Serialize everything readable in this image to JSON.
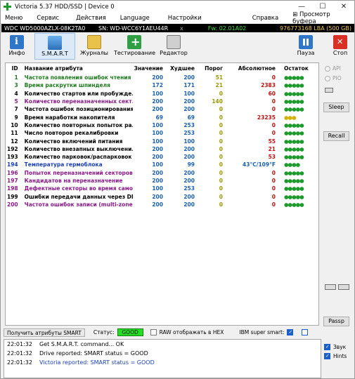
{
  "window": {
    "title": "Victoria 5.37 HDD/SSD | Device 0",
    "controls": [
      "—",
      "☐",
      "✕"
    ]
  },
  "menu": [
    "Меню",
    "Сервис",
    "Действия",
    "Language",
    "Настройки",
    "Справка",
    "Просмотр буфера"
  ],
  "drive": {
    "model": "WDC WD5000AZLX-08K2TA0",
    "serial": "SN: WD-WCC6Y1AEU44R",
    "close": "x",
    "firmware": "Fw: 02.01A02",
    "lba": "976773168 LBA (500 GB)"
  },
  "toolbar": {
    "info": "Инфо",
    "smart": "S.M.A.R.T",
    "logs": "Журналы",
    "test": "Тестирование",
    "editor": "Редактор",
    "pause": "Пауза",
    "stop": "Стоп"
  },
  "table": {
    "headers": [
      "ID",
      "Название атрибута",
      "Значение",
      "Худшее",
      "Порог",
      "Абсолютное",
      "Остаток"
    ],
    "rows": [
      {
        "id": "1",
        "name": "Частота появления ошибок чтения",
        "value": "200",
        "worst": "200",
        "threshold": "51",
        "raw": "0",
        "rest": "●●●●●",
        "color": "green"
      },
      {
        "id": "3",
        "name": "Время раскрутки шпинделя",
        "value": "172",
        "worst": "171",
        "threshold": "21",
        "raw": "2383",
        "rest": "●●●●●",
        "color": "green"
      },
      {
        "id": "4",
        "name": "Количество стартов или пробужде...",
        "value": "100",
        "worst": "100",
        "threshold": "0",
        "raw": "60",
        "rest": "●●●●●",
        "color": "black"
      },
      {
        "id": "5",
        "name": "Количество переназначенных сект...",
        "value": "200",
        "worst": "200",
        "threshold": "140",
        "raw": "0",
        "rest": "●●●●●",
        "color": "purple"
      },
      {
        "id": "7",
        "name": "Частота ошибок позиционирования",
        "value": "200",
        "worst": "200",
        "threshold": "0",
        "raw": "0",
        "rest": "●●●●●",
        "color": "black"
      },
      {
        "id": "9",
        "name": "Время наработки накопителя",
        "value": "69",
        "worst": "69",
        "threshold": "0",
        "raw": "23235",
        "rest": "●●●",
        "color": "black",
        "rest_color": "yellow"
      },
      {
        "id": "10",
        "name": "Количество повторных попыток ра...",
        "value": "100",
        "worst": "253",
        "threshold": "0",
        "raw": "0",
        "rest": "●●●●●",
        "color": "black"
      },
      {
        "id": "11",
        "name": "Число повторов рекалибровки",
        "value": "100",
        "worst": "253",
        "threshold": "0",
        "raw": "0",
        "rest": "●●●●●",
        "color": "black"
      },
      {
        "id": "12",
        "name": "Количество включений питания",
        "value": "100",
        "worst": "100",
        "threshold": "0",
        "raw": "55",
        "rest": "●●●●●",
        "color": "black"
      },
      {
        "id": "192",
        "name": "Количество внезапных выключени...",
        "value": "200",
        "worst": "200",
        "threshold": "0",
        "raw": "21",
        "rest": "●●●●●",
        "color": "black"
      },
      {
        "id": "193",
        "name": "Количество парковок/распарковок",
        "value": "200",
        "worst": "200",
        "threshold": "0",
        "raw": "53",
        "rest": "●●●●●",
        "color": "black"
      },
      {
        "id": "194",
        "name": "Температура гермоблока",
        "value": "100",
        "worst": "99",
        "threshold": "0",
        "raw": "43°C/109°F",
        "rest": "●●●●",
        "color": "blue",
        "raw_color": "blue"
      },
      {
        "id": "196",
        "name": "Попыток переназначений секторов",
        "value": "200",
        "worst": "200",
        "threshold": "0",
        "raw": "0",
        "rest": "●●●●●",
        "color": "purple"
      },
      {
        "id": "197",
        "name": "Кандидатов на переназначение",
        "value": "200",
        "worst": "200",
        "threshold": "0",
        "raw": "0",
        "rest": "●●●●●",
        "color": "purple"
      },
      {
        "id": "198",
        "name": "Дефектные секторы во время само...",
        "value": "100",
        "worst": "253",
        "threshold": "0",
        "raw": "0",
        "rest": "●●●●●",
        "color": "purple"
      },
      {
        "id": "199",
        "name": "Ошибки передачи данных через DMA",
        "value": "200",
        "worst": "200",
        "threshold": "0",
        "raw": "0",
        "rest": "●●●●●",
        "color": "black"
      },
      {
        "id": "200",
        "name": "Частота ошибок записи (multi-zone ...",
        "value": "200",
        "worst": "200",
        "threshold": "0",
        "raw": "0",
        "rest": "●●●●●",
        "color": "purple"
      }
    ]
  },
  "side": {
    "api": "API",
    "pio": "PIO",
    "sleep": "Sleep",
    "recall": "Recall",
    "passp": "Passp"
  },
  "status": {
    "get_attrs": "Получить атрибуты SMART",
    "status_label": "Статус:",
    "status_value": "GOOD",
    "raw_hex": "RAW отображать в HEX",
    "ibm": "IBM super smart:"
  },
  "log": [
    {
      "time": "22:01:32",
      "msg": "Get S.M.A.R.T. command... OK",
      "blue": false
    },
    {
      "time": "22:01:32",
      "msg": "Drive reported: SMART status = GOOD",
      "blue": false
    },
    {
      "time": "22:01:32",
      "msg": "Victoria reported: SMART status = GOOD",
      "blue": true
    }
  ],
  "log_side": {
    "sound": "Звук",
    "hints": "Hints"
  }
}
